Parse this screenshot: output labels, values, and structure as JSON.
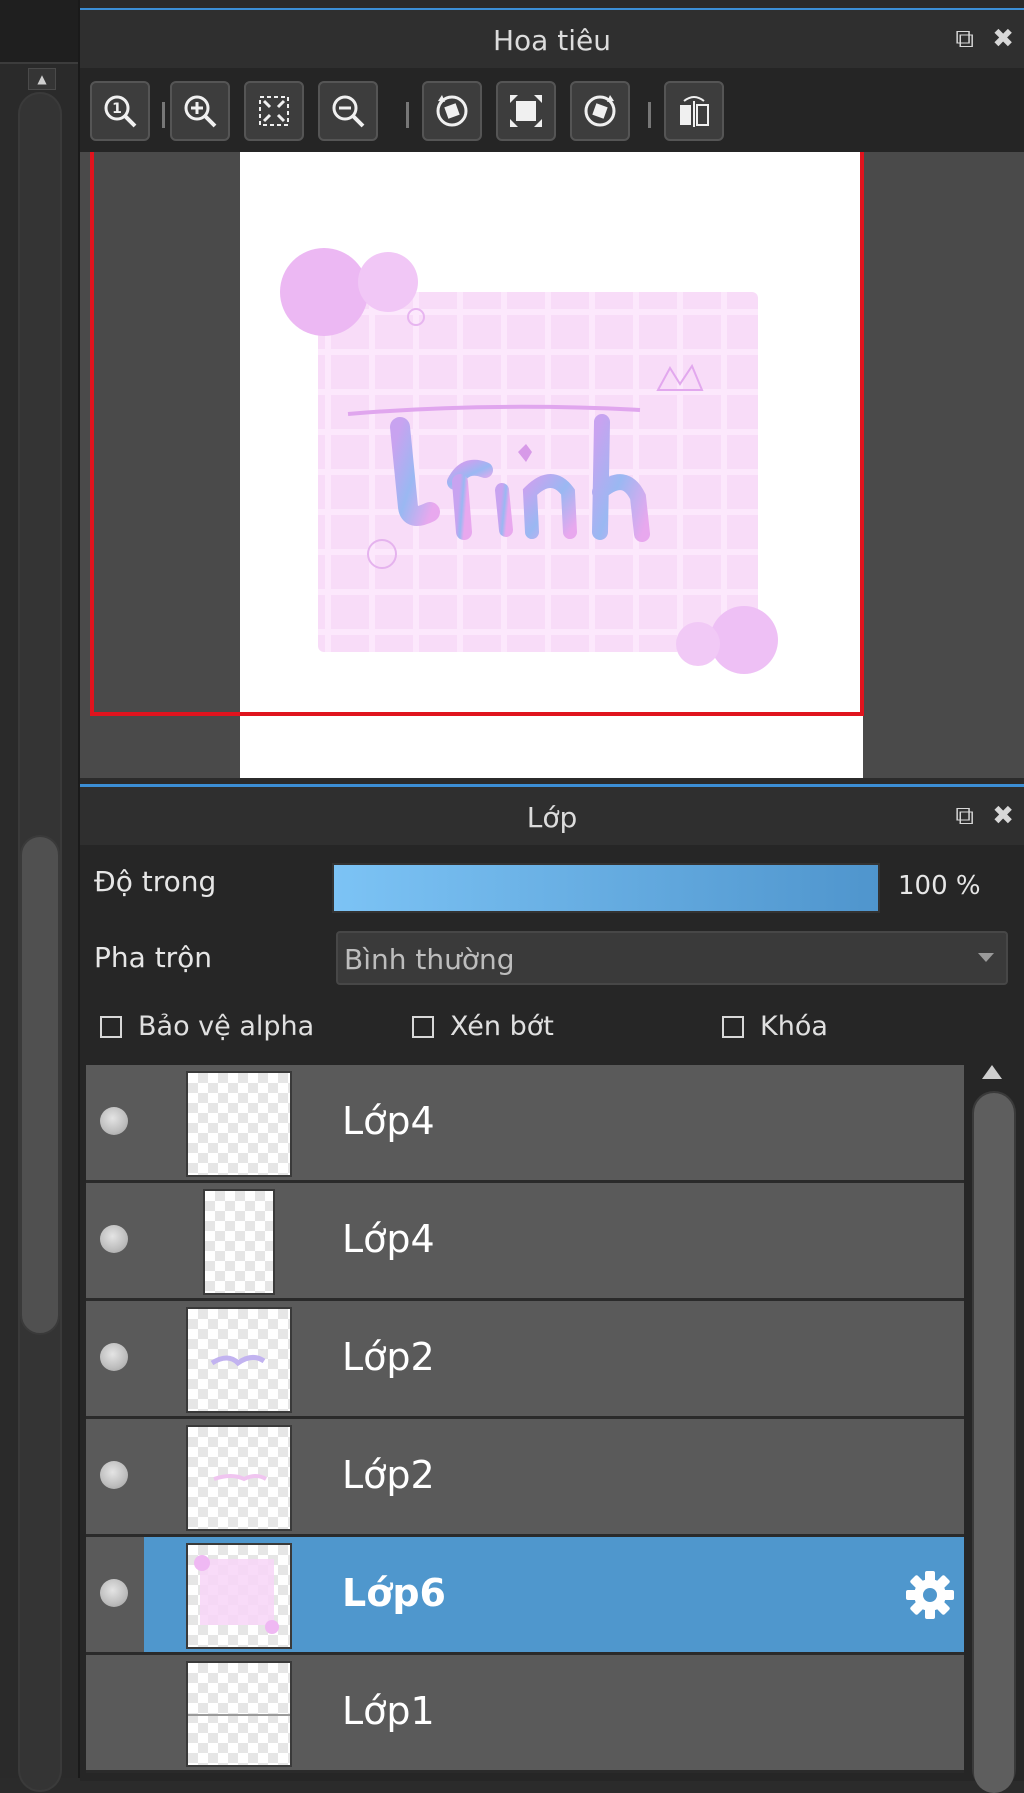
{
  "navigator": {
    "title": "Hoa tiêu",
    "toolbar": [
      "zoom-actual-size",
      "zoom-in",
      "fit-to-window",
      "zoom-out",
      "rotate-left",
      "fill-window",
      "rotate-right",
      "flip-horizontal"
    ]
  },
  "layers_panel": {
    "title": "Lớp",
    "opacity_label": "Độ trong",
    "opacity_value": "100 %",
    "opacity_fraction": 1.0,
    "blend_label": "Pha trộn",
    "blend_value": "Bình thường",
    "checkboxes": {
      "alpha_protect": "Bảo vệ alpha",
      "clipping": "Xén bớt",
      "lock": "Khóa"
    },
    "layers": [
      {
        "name": "Lớp4",
        "selected": false
      },
      {
        "name": "Lớp4",
        "selected": false
      },
      {
        "name": "Lớp2",
        "selected": false
      },
      {
        "name": "Lớp2",
        "selected": false
      },
      {
        "name": "Lớp6",
        "selected": true
      },
      {
        "name": "Lớp1",
        "selected": false
      }
    ]
  },
  "colors": {
    "accent": "#4f97cd",
    "viewport_border": "#e0141e",
    "panel_bg": "#2e2e2e"
  }
}
